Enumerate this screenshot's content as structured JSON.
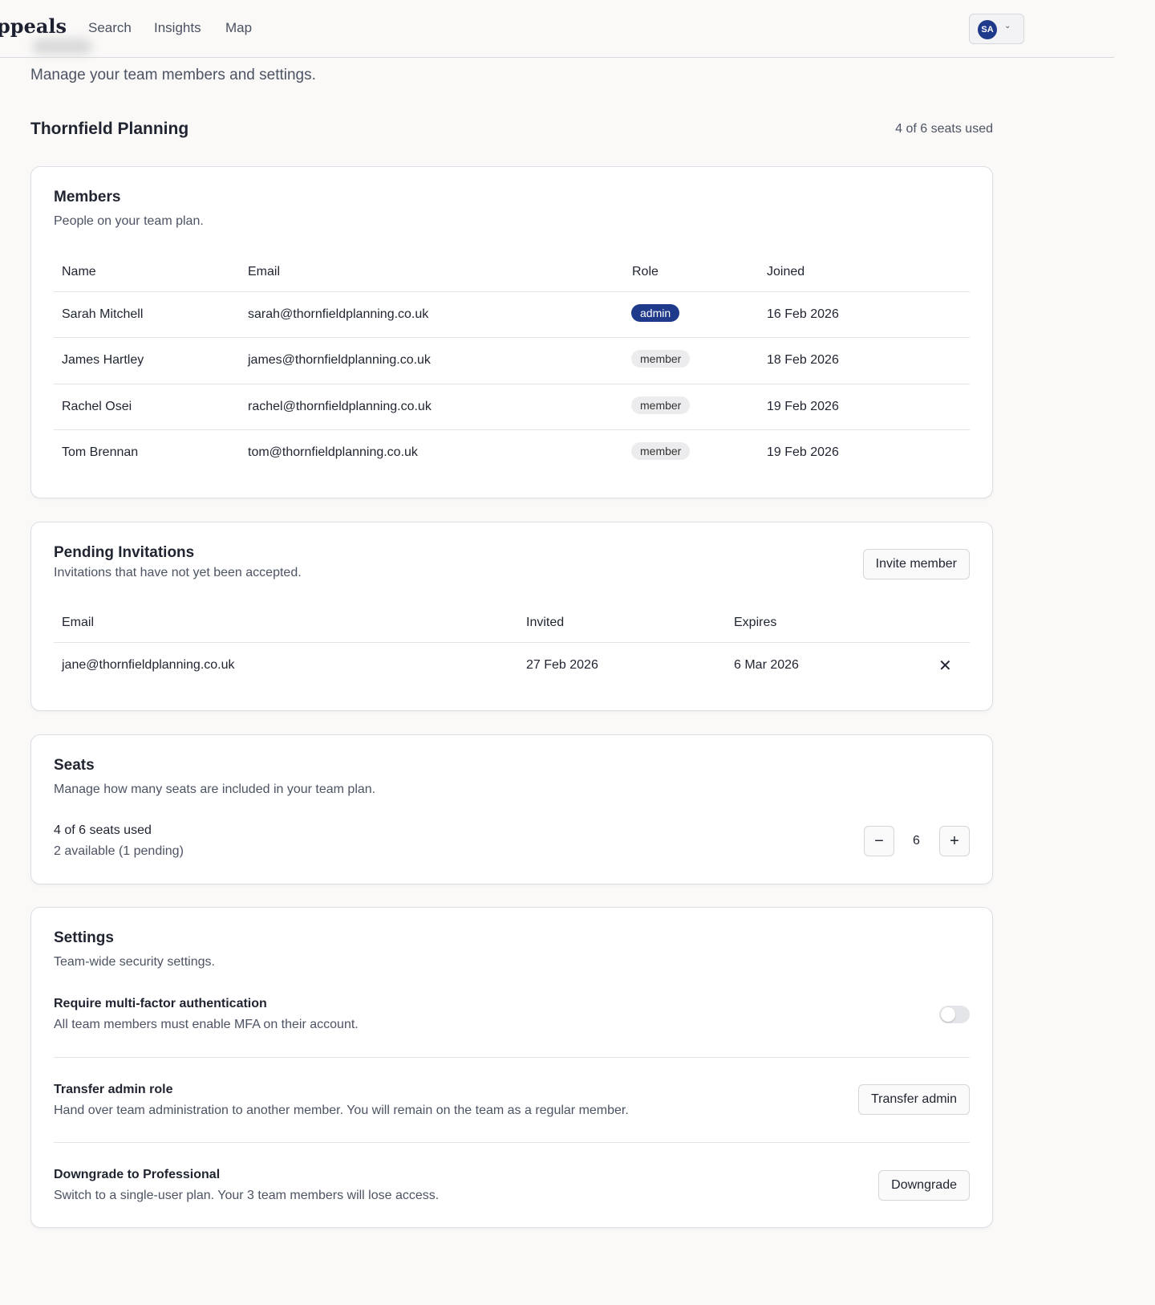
{
  "header": {
    "logo": "ppeals",
    "nav": [
      "Search",
      "Insights",
      "Map"
    ],
    "avatar_initials": "SA"
  },
  "page": {
    "subtitle": "Manage your team members and settings.",
    "team_name": "Thornfield Planning",
    "seats_used": "4 of 6 seats used"
  },
  "members": {
    "title": "Members",
    "description": "People on your team plan.",
    "columns": [
      "Name",
      "Email",
      "Role",
      "Joined"
    ],
    "rows": [
      {
        "name": "Sarah Mitchell",
        "email": "sarah@thornfieldplanning.co.uk",
        "role": "admin",
        "joined": "16 Feb 2026"
      },
      {
        "name": "James Hartley",
        "email": "james@thornfieldplanning.co.uk",
        "role": "member",
        "joined": "18 Feb 2026"
      },
      {
        "name": "Rachel Osei",
        "email": "rachel@thornfieldplanning.co.uk",
        "role": "member",
        "joined": "19 Feb 2026"
      },
      {
        "name": "Tom Brennan",
        "email": "tom@thornfieldplanning.co.uk",
        "role": "member",
        "joined": "19 Feb 2026"
      }
    ]
  },
  "invitations": {
    "title": "Pending Invitations",
    "description": "Invitations that have not yet been accepted.",
    "invite_button": "Invite member",
    "columns": [
      "Email",
      "Invited",
      "Expires"
    ],
    "rows": [
      {
        "email": "jane@thornfieldplanning.co.uk",
        "invited": "27 Feb 2026",
        "expires": "6 Mar 2026"
      }
    ]
  },
  "seats": {
    "title": "Seats",
    "description": "Manage how many seats are included in your team plan.",
    "used": "4 of 6 seats used",
    "available": "2 available (1 pending)",
    "count": "6",
    "decrement": "−",
    "increment": "+"
  },
  "settings": {
    "title": "Settings",
    "description": "Team-wide security settings.",
    "mfa": {
      "title": "Require multi-factor authentication",
      "description": "All team members must enable MFA on their account.",
      "enabled": false
    },
    "transfer": {
      "title": "Transfer admin role",
      "description": "Hand over team administration to another member. You will remain on the team as a regular member.",
      "button": "Transfer admin"
    },
    "downgrade": {
      "title": "Downgrade to Professional",
      "description": "Switch to a single-user plan. Your 3 team members will lose access.",
      "button": "Downgrade"
    }
  },
  "colors": {
    "accent": "#1f3a8a"
  }
}
